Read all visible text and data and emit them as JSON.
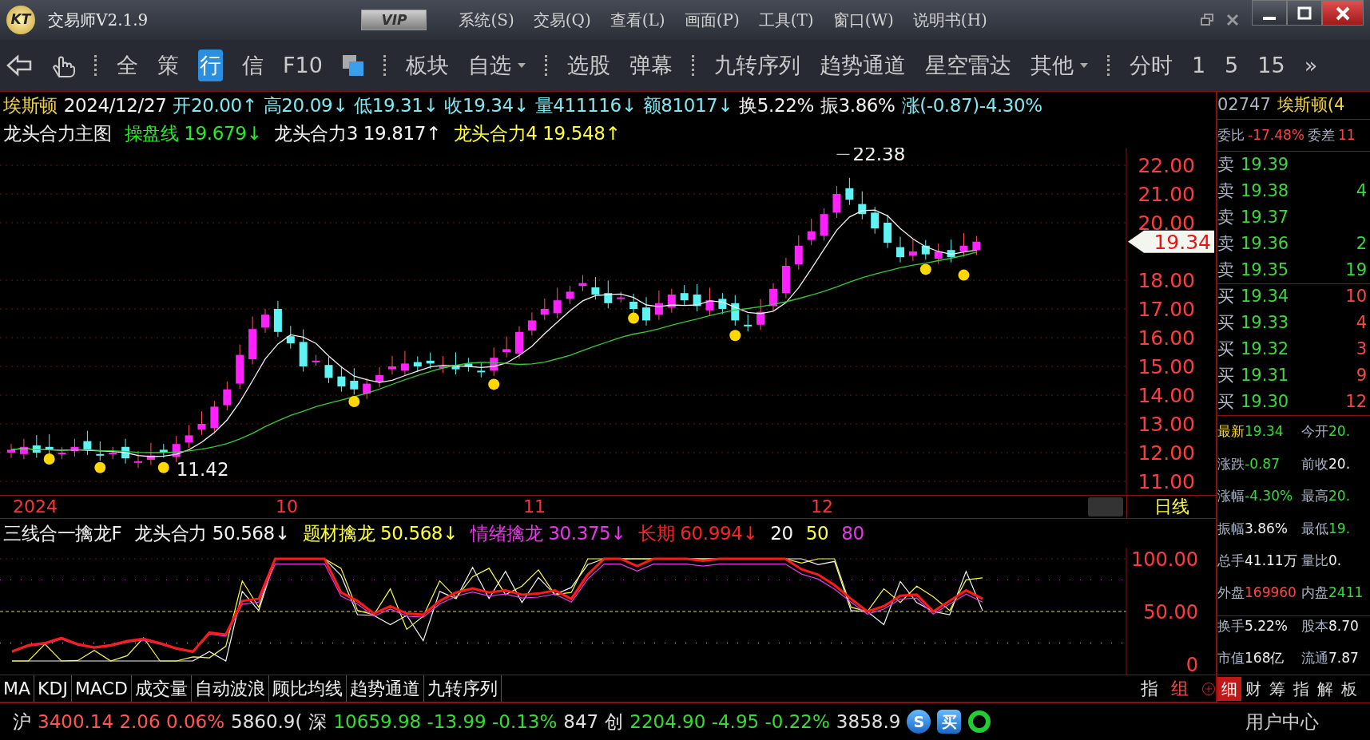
{
  "window": {
    "logo": "KT",
    "title": "交易师V2.1.9",
    "badge": "VIP",
    "menu": [
      "系统(S)",
      "交易(Q)",
      "查看(L)",
      "画面(P)",
      "工具(T)",
      "窗口(W)",
      "说明书(H)"
    ]
  },
  "toolbar": [
    {
      "kind": "tab",
      "label": "全",
      "selected": false
    },
    {
      "kind": "tab",
      "label": "策",
      "selected": false
    },
    {
      "kind": "tab",
      "label": "行",
      "selected": true
    },
    {
      "kind": "tab",
      "label": "信",
      "selected": false
    },
    {
      "kind": "tab",
      "label": "F10",
      "selected": false
    },
    {
      "kind": "square"
    },
    {
      "kind": "sep"
    },
    {
      "kind": "link",
      "label": "板块"
    },
    {
      "kind": "dropdown",
      "label": "自选"
    },
    {
      "kind": "sep"
    },
    {
      "kind": "link",
      "label": "选股"
    },
    {
      "kind": "link",
      "label": "弹幕"
    },
    {
      "kind": "sep"
    },
    {
      "kind": "link",
      "label": "九转序列"
    },
    {
      "kind": "link",
      "label": "趋势通道"
    },
    {
      "kind": "link",
      "label": "星空雷达"
    },
    {
      "kind": "dropdown",
      "label": "其他"
    },
    {
      "kind": "sep"
    },
    {
      "kind": "link",
      "label": "分时"
    },
    {
      "kind": "link",
      "label": "1"
    },
    {
      "kind": "link",
      "label": "5"
    },
    {
      "kind": "link",
      "label": "15"
    },
    {
      "kind": "link",
      "label": "»"
    }
  ],
  "quote": {
    "name": "埃斯顿",
    "date": "2024/12/27",
    "fields": [
      {
        "text": "开20.00↑",
        "color": "#7ee8f2"
      },
      {
        "text": "高20.09↓",
        "color": "#7ee8f2"
      },
      {
        "text": "低19.31↓",
        "color": "#7ee8f2"
      },
      {
        "text": "收19.34↓",
        "color": "#7ee8f2"
      },
      {
        "text": "量411116↓",
        "color": "#7ee8f2"
      },
      {
        "text": "额81017↓",
        "color": "#7ee8f2"
      },
      {
        "text": "换5.22%",
        "color": "#f0f0f0"
      },
      {
        "text": "振3.86%",
        "color": "#f0f0f0"
      },
      {
        "text": "涨(-0.87)-4.30%",
        "color": "#7ee8f2"
      }
    ]
  },
  "main_indicator": {
    "title": "龙头合力主图",
    "lines": [
      {
        "text": "操盘线 19.679↓",
        "color": "#22ee22"
      },
      {
        "text": "龙头合力3 19.817↑",
        "color": "#f4f4f4"
      },
      {
        "text": "龙头合力4 19.548↑",
        "color": "#ffff33"
      }
    ]
  },
  "price_axis": [
    "22.00",
    "21.00",
    "20.00",
    "18.00",
    "17.00",
    "16.00",
    "15.00",
    "14.00",
    "13.00",
    "12.00",
    "11.00"
  ],
  "last_price": "19.34",
  "high_label": "22.38",
  "low_label": "11.42",
  "date_axis": [
    "2024",
    "10",
    "11",
    "12"
  ],
  "period": "日线",
  "sub_indicator": {
    "title": "三线合一擒龙F",
    "lines": [
      {
        "text": "龙头合力 50.568↓",
        "color": "#f4f4f4"
      },
      {
        "text": "题材擒龙 50.568↓",
        "color": "#ffff33"
      },
      {
        "text": "情绪擒龙 30.375↓",
        "color": "#ee33ee"
      },
      {
        "text": "长期 60.994↓",
        "color": "#ff2222"
      },
      {
        "text": "20",
        "color": "#f4f4f4"
      },
      {
        "text": "50",
        "color": "#ffff33"
      },
      {
        "text": "80",
        "color": "#ee33ee"
      }
    ],
    "axis": [
      "100.00",
      "50.00",
      "0"
    ]
  },
  "indicator_tabs": [
    "MA",
    "KDJ",
    "MACD",
    "成交量",
    "自动波浪",
    "顾比均线",
    "趋势通道",
    "九转序列"
  ],
  "group_tabs": [
    {
      "label": "指",
      "selected": false
    },
    {
      "label": "组",
      "selected": true
    }
  ],
  "panel": {
    "code": "02747",
    "name": "埃斯顿(4",
    "ratio": [
      {
        "label": "委比",
        "value": "-17.48%"
      },
      {
        "label": "委差",
        "value": "11"
      }
    ],
    "orders": [
      {
        "kind": "sell",
        "side": "卖",
        "price": "19.39"
      },
      {
        "kind": "sell",
        "side": "卖",
        "price": "19.38",
        "volume": "4"
      },
      {
        "kind": "sell",
        "side": "卖",
        "price": "19.37"
      },
      {
        "kind": "sell",
        "side": "卖",
        "price": "19.36",
        "volume": "2"
      },
      {
        "kind": "sell",
        "side": "卖",
        "price": "19.35",
        "volume": "19"
      },
      {
        "kind": "buy",
        "side": "买",
        "price": "19.34",
        "volume": "10"
      },
      {
        "kind": "buy",
        "side": "买",
        "price": "19.33",
        "volume": "4"
      },
      {
        "kind": "buy",
        "side": "买",
        "price": "19.32",
        "volume": "3"
      },
      {
        "kind": "buy",
        "side": "买",
        "price": "19.31",
        "volume": "9"
      },
      {
        "kind": "buy",
        "side": "买",
        "price": "19.30",
        "volume": "12"
      }
    ],
    "stats": [
      {
        "label": "最新",
        "value": "19.34",
        "color": "#33dd33",
        "highlight": true
      },
      {
        "label": "今开",
        "value": "20.",
        "color": "#33dd33",
        "highlight": false
      },
      {
        "label": "涨跌",
        "value": "-0.87",
        "color": "#33dd33",
        "highlight": false
      },
      {
        "label": "前收",
        "value": "20.",
        "color": "#f0f0f0",
        "highlight": false
      },
      {
        "label": "涨幅",
        "value": "-4.30%",
        "color": "#33dd33",
        "highlight": false
      },
      {
        "label": "最高",
        "value": "20.",
        "color": "#33dd33",
        "highlight": false
      },
      {
        "label": "振幅",
        "value": "3.86%",
        "color": "#f0f0f0",
        "highlight": false
      },
      {
        "label": "最低",
        "value": "19.",
        "color": "#33dd33",
        "highlight": false
      },
      {
        "label": "总手",
        "value": "41.11万",
        "color": "#f0f0f0",
        "highlight": false
      },
      {
        "label": "量比",
        "value": "0.",
        "color": "#f0f0f0",
        "highlight": false
      },
      {
        "label": "外盘",
        "value": "169960",
        "color": "#ff4444",
        "highlight": false
      },
      {
        "label": "内盘",
        "value": "2411",
        "color": "#33dd33",
        "highlight": false
      },
      {
        "label": "换手",
        "value": "5.22%",
        "color": "#f0f0f0",
        "highlight": false
      },
      {
        "label": "股本",
        "value": "8.70",
        "color": "#f0f0f0",
        "highlight": false
      },
      {
        "label": "市值",
        "value": "168亿",
        "color": "#f0f0f0",
        "highlight": false
      },
      {
        "label": "流通",
        "value": "7.87",
        "color": "#f0f0f0",
        "highlight": false
      }
    ],
    "tabs": [
      {
        "label": "细",
        "selected": true
      },
      {
        "label": "财",
        "selected": false
      },
      {
        "label": "筹",
        "selected": false
      },
      {
        "label": "指",
        "selected": false
      },
      {
        "label": "解",
        "selected": false
      },
      {
        "label": "板",
        "selected": false
      }
    ]
  },
  "status_bar": {
    "markets": [
      {
        "label": "沪",
        "quote": "3400.14 2.06 0.06%",
        "color": "#ff5555",
        "amount": "5860.9("
      },
      {
        "label": "深",
        "quote": "10659.98 -13.99 -0.13%",
        "color": "#33dd33",
        "amount": "847"
      },
      {
        "label": "创",
        "quote": "2204.90 -4.95 -0.22%",
        "color": "#33dd33",
        "amount": "3858.9"
      }
    ],
    "buttons": [
      "S",
      "买"
    ],
    "user_center": "用户中心"
  }
}
